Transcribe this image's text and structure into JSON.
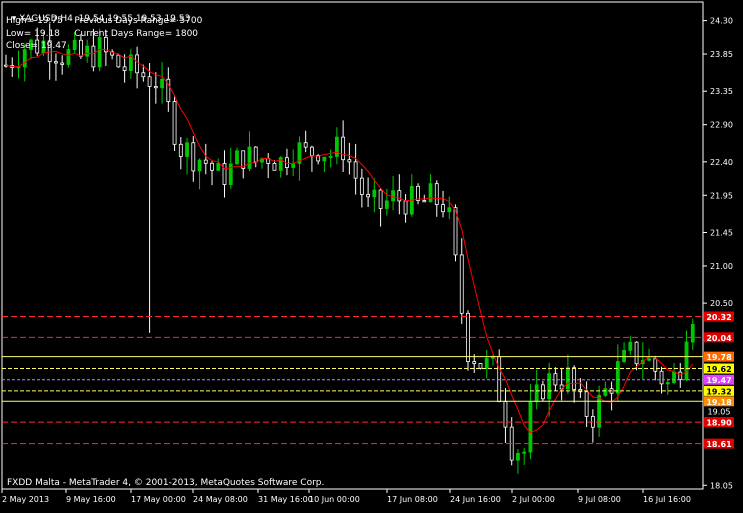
{
  "header": {
    "symbol_line": "XAGUSD,H4  19.54 19.55 19.53 19.53",
    "high_text": "High= 19.75",
    "prev_range_text": "Previous Days Range= 5700",
    "low_text": "Low= 19.18",
    "curr_range_text": "Current Days Range= 1800",
    "close_text": "Close= 19.47"
  },
  "footer": {
    "copyright": "FXDD Malta - MetaTrader 4, © 2001-2013, MetaQuotes Software Corp."
  },
  "colors": {
    "background": "#000000",
    "bull": "#00c800",
    "bear": "#ffffff",
    "ma": "#ff0000",
    "axis": "#ffffff",
    "res_line": "#ff2a2a",
    "yellow_line": "#ffff66",
    "pivot_line": "#c080ff"
  },
  "chart_data": {
    "type": "candlestick",
    "title": "XAGUSD,H4",
    "x_tick_labels": [
      "2 May 2013",
      "9 May 16:00",
      "17 May 00:00",
      "24 May 08:00",
      "31 May 16:00",
      "10 Jun 00:00",
      "17 Jun 08:00",
      "24 Jun 16:00",
      "2 Jul 00:00",
      "9 Jul 08:00",
      "16 Jul 16:00"
    ],
    "y_tick_labels": [
      "24.30",
      "23.85",
      "23.35",
      "22.90",
      "22.40",
      "21.95",
      "21.45",
      "21.00",
      "20.50",
      "18.05"
    ],
    "ylim": [
      18.0,
      24.55
    ],
    "close_path": [
      [
        0,
        23.7
      ],
      [
        3,
        23.95
      ],
      [
        6,
        24.0
      ],
      [
        9,
        23.85
      ],
      [
        12,
        23.8
      ],
      [
        15,
        23.9
      ],
      [
        18,
        23.7
      ],
      [
        21,
        23.6
      ],
      [
        24,
        23.5
      ],
      [
        26,
        23.1
      ],
      [
        28,
        22.6
      ],
      [
        30,
        22.5
      ],
      [
        32,
        22.4
      ],
      [
        34,
        22.2
      ],
      [
        36,
        22.3
      ],
      [
        38,
        22.5
      ],
      [
        40,
        22.4
      ],
      [
        42,
        22.5
      ],
      [
        44,
        22.4
      ],
      [
        46,
        22.6
      ],
      [
        48,
        22.5
      ],
      [
        50,
        22.6
      ],
      [
        52,
        22.5
      ],
      [
        54,
        22.6
      ],
      [
        56,
        22.2
      ],
      [
        58,
        21.8
      ],
      [
        60,
        21.8
      ],
      [
        62,
        21.9
      ],
      [
        64,
        21.9
      ],
      [
        66,
        21.8
      ],
      [
        68,
        21.9
      ],
      [
        70,
        21.85
      ],
      [
        71,
        21.6
      ],
      [
        72,
        21.0
      ],
      [
        73,
        20.4
      ],
      [
        74,
        19.9
      ],
      [
        76,
        19.7
      ],
      [
        78,
        19.6
      ],
      [
        80,
        19.0
      ],
      [
        81,
        18.6
      ],
      [
        83,
        18.5
      ],
      [
        84,
        19.0
      ],
      [
        86,
        19.4
      ],
      [
        88,
        19.5
      ],
      [
        90,
        19.5
      ],
      [
        92,
        19.1
      ],
      [
        94,
        19.0
      ],
      [
        96,
        19.3
      ],
      [
        98,
        19.6
      ],
      [
        100,
        19.8
      ],
      [
        102,
        19.8
      ],
      [
        104,
        19.6
      ],
      [
        106,
        19.4
      ],
      [
        107,
        19.5
      ],
      [
        108,
        19.7
      ],
      [
        109,
        20.2
      ],
      [
        110,
        20.4
      ]
    ],
    "horizontal_levels": [
      {
        "label": "20.32",
        "value": 20.32,
        "style": "red-dash"
      },
      {
        "label": "20.04",
        "value": 20.04,
        "style": "red-dash"
      },
      {
        "label": "19.78",
        "value": 19.78,
        "style": "yellow-solid"
      },
      {
        "label": "19.62",
        "value": 19.62,
        "style": "yellow-dash"
      },
      {
        "label": "19.47",
        "value": 19.47,
        "style": "pivot-dash"
      },
      {
        "label": "19.32",
        "value": 19.32,
        "style": "yellow-dash"
      },
      {
        "label": "19.18",
        "value": 19.18,
        "style": "yellow-solid"
      },
      {
        "label": "19.05",
        "value": 19.05,
        "style": "none"
      },
      {
        "label": "18.90",
        "value": 18.9,
        "style": "red-dash"
      },
      {
        "label": "18.61",
        "value": 18.61,
        "style": "red-dash"
      }
    ]
  }
}
